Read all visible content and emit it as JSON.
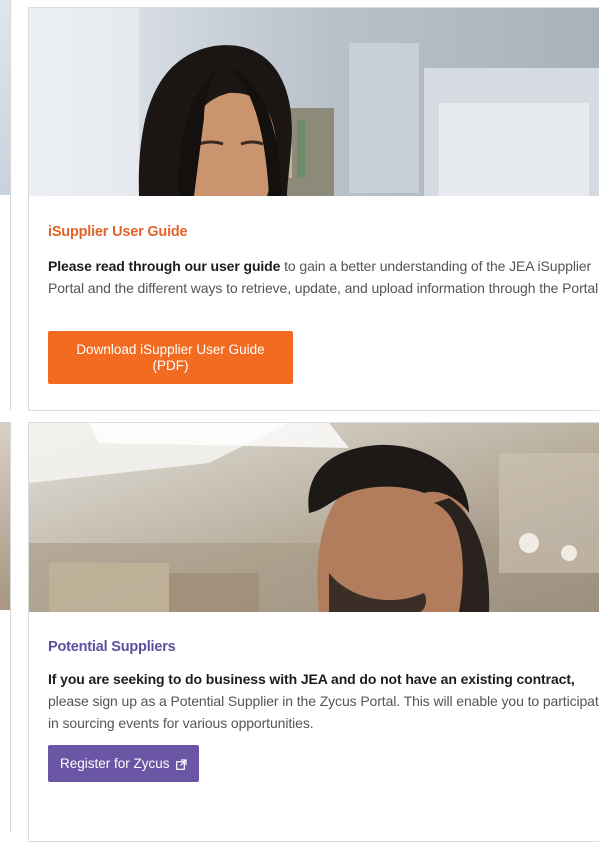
{
  "cards": [
    {
      "title": "iSupplier User Guide",
      "intro_bold": "Please read through our user guide",
      "intro_rest": " to gain a better understanding of the JEA iSupplier Portal and the different ways to retrieve, update, and upload information through the Portal.",
      "button_label": "Download iSupplier User Guide (PDF)",
      "accent": "#f26b21",
      "image_alt": "woman-looking-down-photo"
    },
    {
      "title": "Potential Suppliers",
      "intro_bold": "If you are seeking to do business with JEA and do not have an existing contract,",
      "intro_rest": " please sign up as a Potential Supplier in the Zycus Portal. This will enable you to participate in sourcing events for various opportunities.",
      "button_label": "Register for Zycus",
      "button_icon": "external-link-icon",
      "accent": "#6a56a5",
      "image_alt": "man-looking-down-photo"
    }
  ]
}
